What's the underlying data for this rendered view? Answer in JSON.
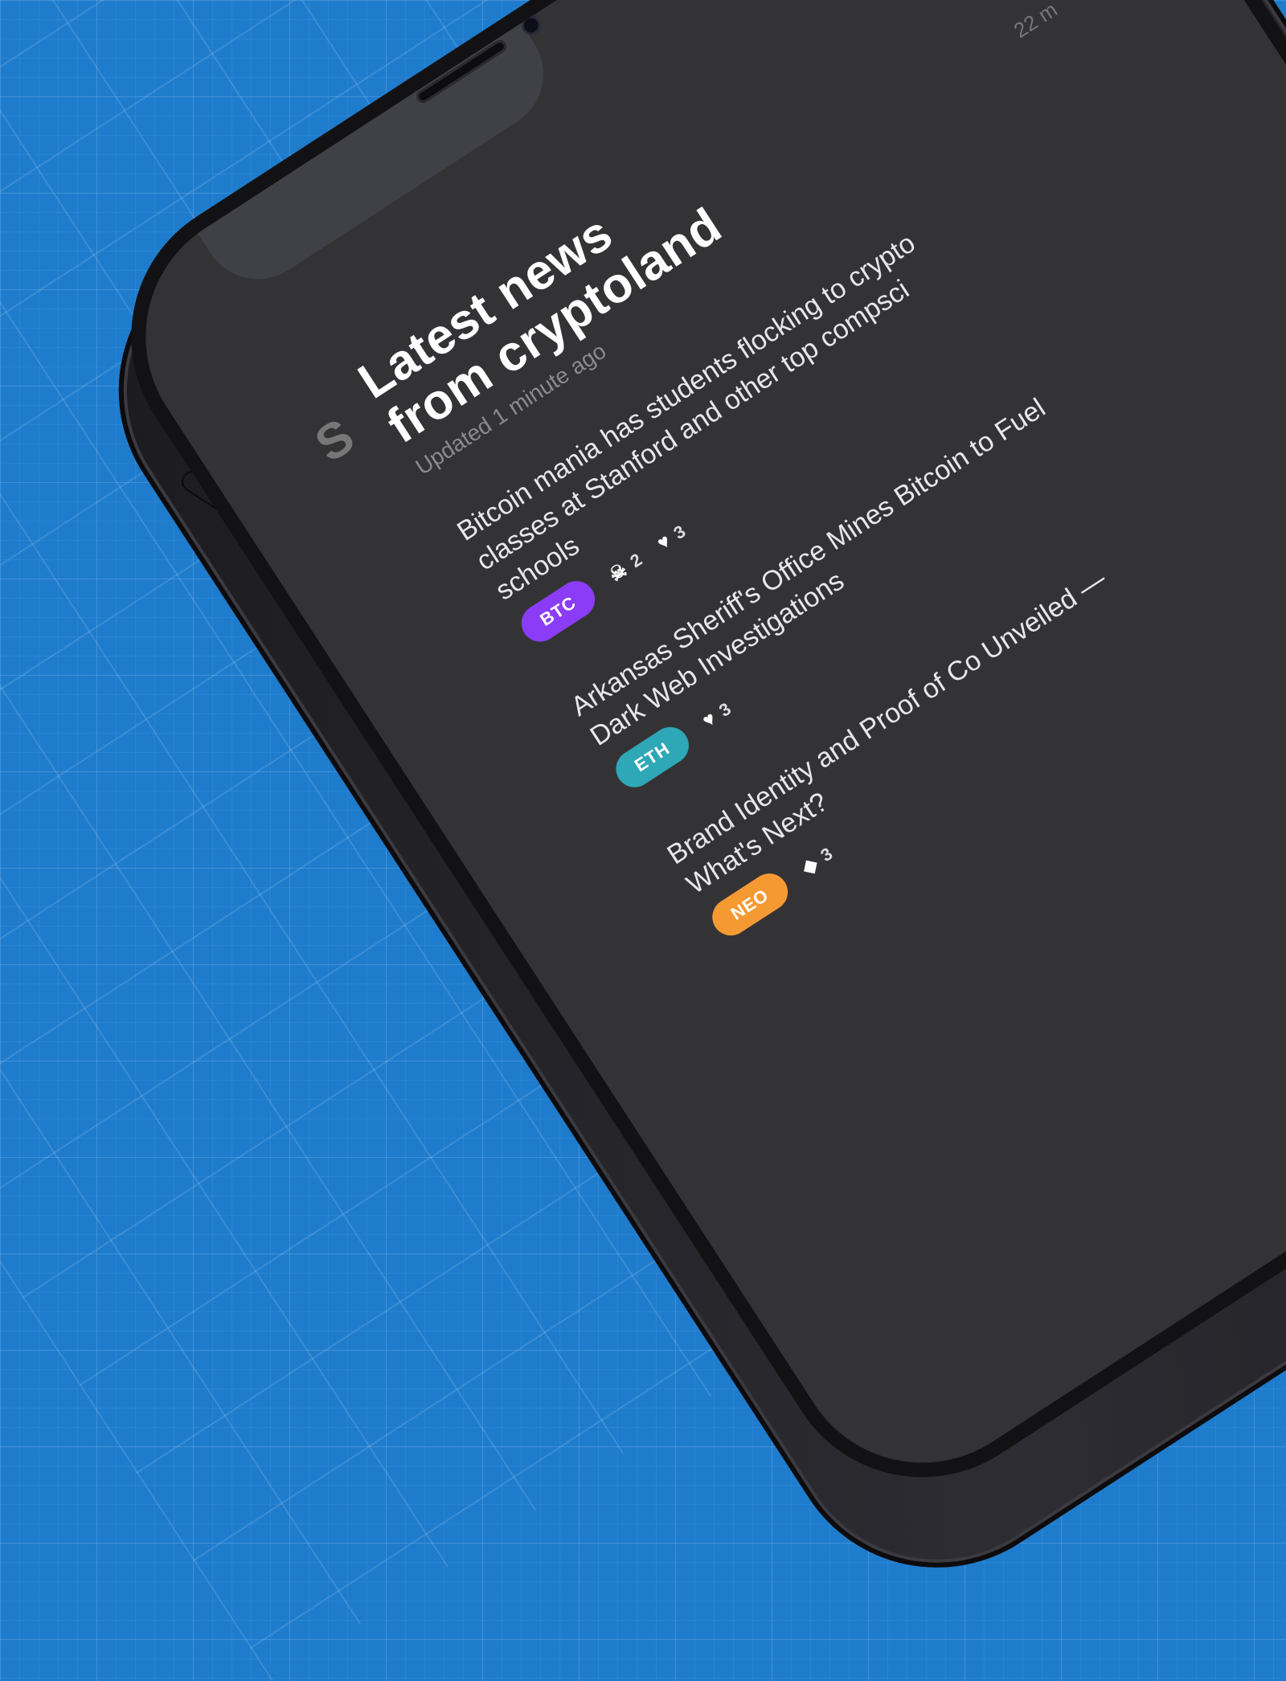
{
  "header": {
    "headline": "Latest news\nfrom cryptoland",
    "updated": "Updated 1 minute ago",
    "time_ago": "22 m"
  },
  "articles": [
    {
      "title": "Bitcoin mania has students flocking to crypto classes at Stanford and other top compsci schools",
      "tag": "BTC",
      "tag_color": "#8b3cf6",
      "stats": [
        {
          "icon": "skull-icon",
          "glyph": "☠",
          "count": "2"
        },
        {
          "icon": "heart-icon",
          "glyph": "♥",
          "count": "3"
        }
      ]
    },
    {
      "title": "Arkansas Sheriff's Office Mines Bitcoin to Fuel Dark Web Investigations",
      "tag": "ETH",
      "tag_color": "#2ea8b6",
      "stats": [
        {
          "icon": "heart-icon",
          "glyph": "♥",
          "count": "3"
        }
      ]
    },
    {
      "title": "Brand Identity and Proof of Co Unveiled — What's Next?",
      "tag": "NEO",
      "tag_color": "#f59a33",
      "stats": [
        {
          "icon": "diamond-icon",
          "glyph": "◆",
          "count": "3"
        }
      ]
    }
  ],
  "colors": {
    "background": "#1f7ccd",
    "screen": "#333336"
  }
}
